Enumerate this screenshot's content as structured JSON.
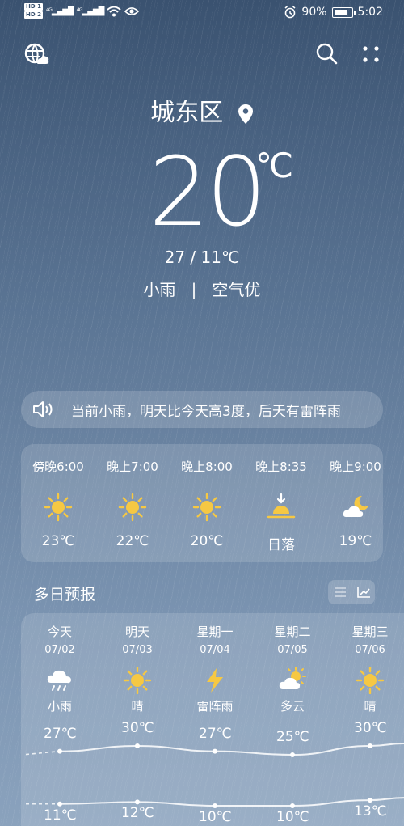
{
  "status_bar": {
    "sim1": "HD 1",
    "sim2": "HD 2",
    "net1": "⁴ᴳ",
    "net2": "⁴ᴳ",
    "battery_percent": "90%",
    "time": "5:02"
  },
  "location": {
    "name": "城东区"
  },
  "current": {
    "temperature": "20",
    "unit": "℃",
    "high_low": "27 / 11℃",
    "condition": "小雨",
    "separator": "|",
    "air_quality": "空气优"
  },
  "notice": {
    "text": "当前小雨，明天比今天高3度，后天有雷阵雨"
  },
  "hourly": [
    {
      "time": "傍晚6:00",
      "icon": "sun-icon",
      "value": "23℃"
    },
    {
      "time": "晚上7:00",
      "icon": "sun-icon",
      "value": "22℃"
    },
    {
      "time": "晚上8:00",
      "icon": "sun-icon",
      "value": "20℃"
    },
    {
      "time": "晚上8:35",
      "icon": "sunset-icon",
      "value": "日落"
    },
    {
      "time": "晚上9:00",
      "icon": "moon-cloud-icon",
      "value": "19℃"
    }
  ],
  "daily_title": "多日预报",
  "daily": [
    {
      "name": "今天",
      "date": "07/02",
      "icon": "rain-cloud-icon",
      "weather": "小雨",
      "high": 27,
      "high_label": "27℃",
      "low": 11,
      "low_label": "11℃"
    },
    {
      "name": "明天",
      "date": "07/03",
      "icon": "sun-icon",
      "weather": "晴",
      "high": 30,
      "high_label": "30℃",
      "low": 12,
      "low_label": "12℃"
    },
    {
      "name": "星期一",
      "date": "07/04",
      "icon": "thunder-icon",
      "weather": "雷阵雨",
      "high": 27,
      "high_label": "27℃",
      "low": 10,
      "low_label": "10℃"
    },
    {
      "name": "星期二",
      "date": "07/05",
      "icon": "partly-cloudy-icon",
      "weather": "多云",
      "high": 25,
      "high_label": "25℃",
      "low": 10,
      "low_label": "10℃"
    },
    {
      "name": "星期三",
      "date": "07/06",
      "icon": "sun-icon",
      "weather": "晴",
      "high": 30,
      "high_label": "30℃",
      "low": 13,
      "low_label": "13℃"
    }
  ]
}
